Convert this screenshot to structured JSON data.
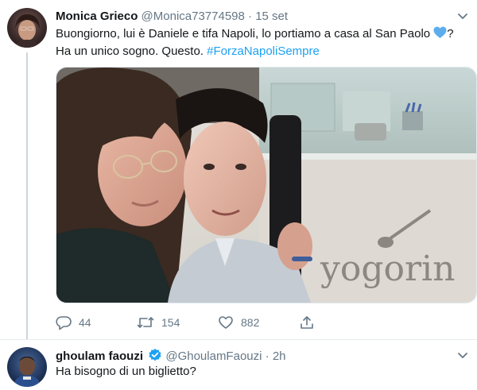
{
  "tweet": {
    "author_name": "Monica Grieco",
    "author_handle": "@Monica73774598",
    "separator": "·",
    "timestamp": "15 set",
    "text_part1": "Buongiorno, lui è Daniele e tifa Napoli, lo portiamo a casa al San Paolo ",
    "text_part2": "?",
    "text_line2": "Ha un unico sogno. Questo. ",
    "hashtag": "#ForzaNapoliSempre",
    "photo_watermark": "yogorin",
    "actions": {
      "reply_count": "44",
      "retweet_count": "154",
      "like_count": "882"
    }
  },
  "reply": {
    "author_name": "ghoulam faouzi",
    "author_handle": "@GhoulamFaouzi",
    "separator": "·",
    "timestamp": "2h",
    "text": "Ha bisogno di un biglietto?"
  },
  "colors": {
    "accent": "#1da1f2",
    "secondary_text": "#657786",
    "primary_text": "#14171a",
    "heart_emoji": "#5dadec"
  },
  "icons": [
    "chevron-down-icon",
    "blue-heart-emoji-icon",
    "reply-icon",
    "retweet-icon",
    "like-icon",
    "share-icon",
    "verified-badge-icon"
  ]
}
